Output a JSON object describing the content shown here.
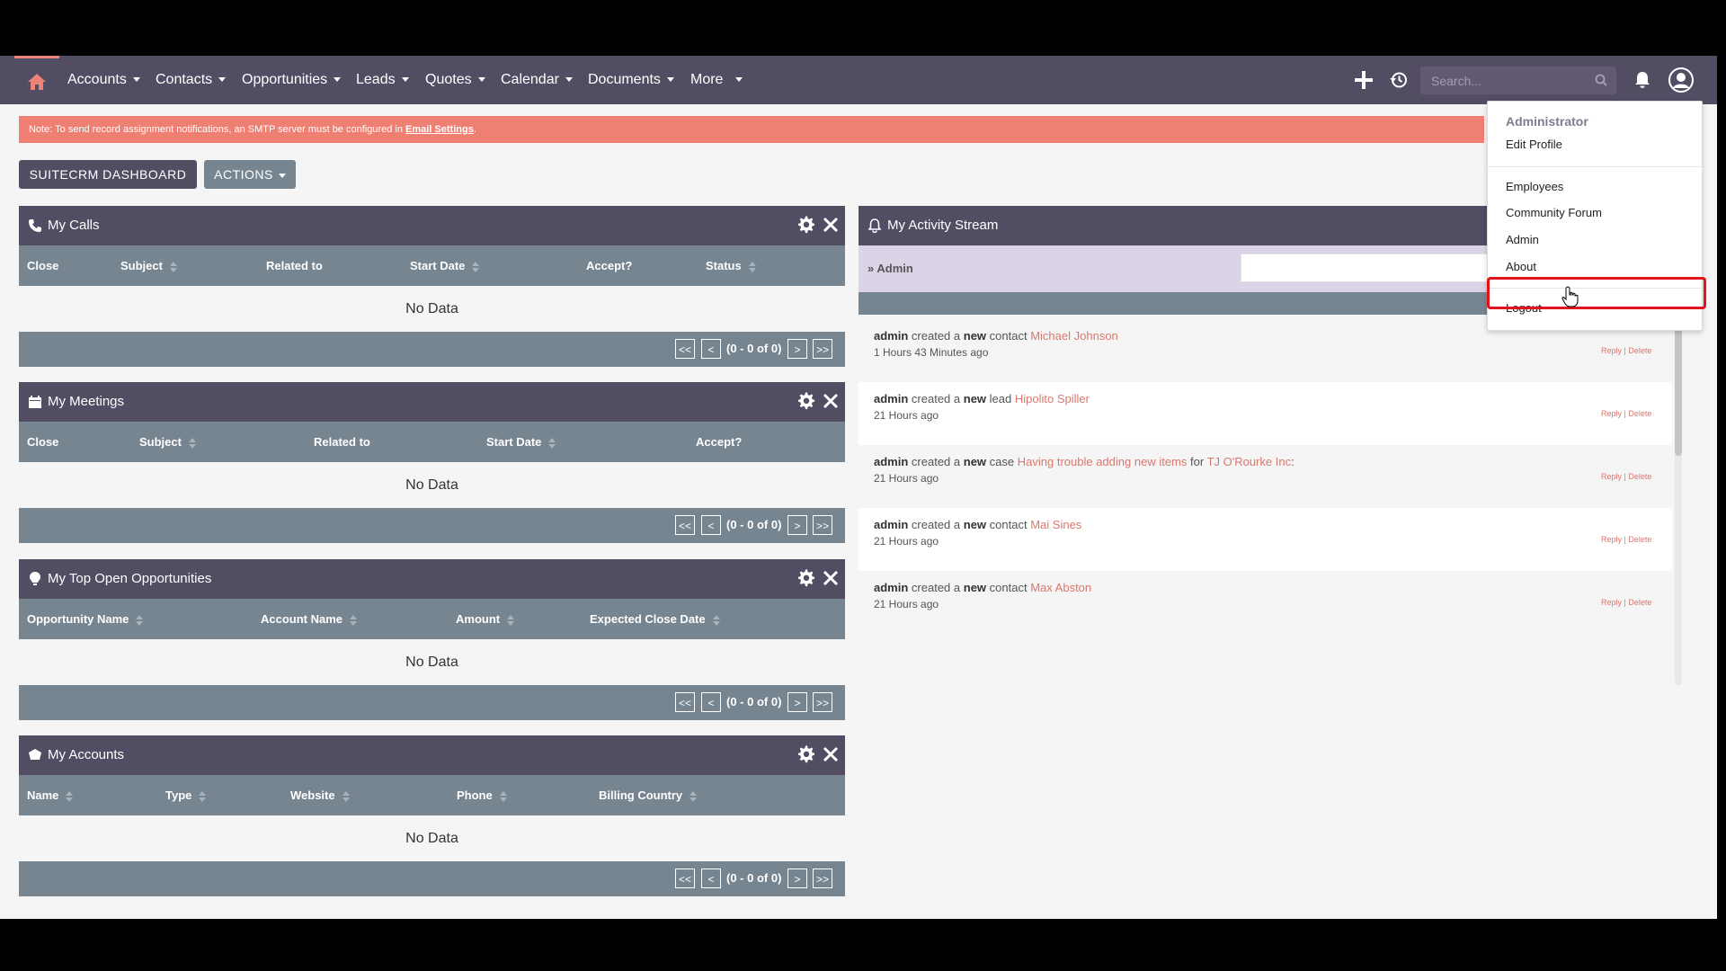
{
  "nav": {
    "items": [
      {
        "label": "Accounts"
      },
      {
        "label": "Contacts"
      },
      {
        "label": "Opportunities"
      },
      {
        "label": "Leads"
      },
      {
        "label": "Quotes"
      },
      {
        "label": "Calendar"
      },
      {
        "label": "Documents"
      },
      {
        "label": "More"
      }
    ],
    "search_placeholder": "Search..."
  },
  "note": {
    "text": "Note: To send record assignment notifications, an SMTP server must be configured in ",
    "link": "Email Settings",
    "suffix": "."
  },
  "buttons": {
    "dashboard": "SUITECRM DASHBOARD",
    "actions": "ACTIONS"
  },
  "dashlets": {
    "calls": {
      "title": "My Calls",
      "columns": [
        "Close",
        "Subject",
        "Related to",
        "Start Date",
        "Accept?",
        "Status"
      ],
      "empty": "No Data",
      "pagination": "(0 - 0 of 0)"
    },
    "meetings": {
      "title": "My Meetings",
      "columns": [
        "Close",
        "Subject",
        "Related to",
        "Start Date",
        "Accept?"
      ],
      "empty": "No Data",
      "pagination": "(0 - 0 of 0)"
    },
    "opportunities": {
      "title": "My Top Open Opportunities",
      "columns": [
        "Opportunity Name",
        "Account Name",
        "Amount",
        "Expected Close Date"
      ],
      "empty": "No Data",
      "pagination": "(0 - 0 of 0)"
    },
    "accounts": {
      "title": "My Accounts",
      "columns": [
        "Name",
        "Type",
        "Website",
        "Phone",
        "Billing Country"
      ],
      "empty": "No Data",
      "pagination": "(0 - 0 of 0)"
    }
  },
  "pager": {
    "first": "<<",
    "prev": "<",
    "next": ">",
    "last": ">>"
  },
  "activity": {
    "title": "My Activity Stream",
    "user_filter": "Admin",
    "entries": [
      {
        "actor": "admin",
        "verb": "created a",
        "kw": "new",
        "type": "contact",
        "target": "Michael Johnson",
        "extra_pre": "",
        "extra_link": "",
        "extra_post": "",
        "time": "1 Hours 43 Minutes ago"
      },
      {
        "actor": "admin",
        "verb": "created a",
        "kw": "new",
        "type": "lead",
        "target": "Hipolito Spiller",
        "extra_pre": "",
        "extra_link": "",
        "extra_post": "",
        "time": "21 Hours ago"
      },
      {
        "actor": "admin",
        "verb": "created a",
        "kw": "new",
        "type": "case",
        "target": "Having trouble adding new items",
        "extra_pre": "for",
        "extra_link": "TJ O'Rourke Inc",
        "extra_post": ":",
        "time": "21 Hours ago"
      },
      {
        "actor": "admin",
        "verb": "created a",
        "kw": "new",
        "type": "contact",
        "target": "Mai Sines",
        "extra_pre": "",
        "extra_link": "",
        "extra_post": "",
        "time": "21 Hours ago"
      },
      {
        "actor": "admin",
        "verb": "created a",
        "kw": "new",
        "type": "contact",
        "target": "Max Abston",
        "extra_pre": "",
        "extra_link": "",
        "extra_post": "",
        "time": "21 Hours ago"
      }
    ],
    "reply": "Reply",
    "delete": "Delete"
  },
  "user_menu": {
    "heading": "Administrator",
    "items": [
      "Edit Profile",
      "Employees",
      "Community Forum",
      "Admin",
      "About",
      "Logout"
    ]
  },
  "colors": {
    "nav_bg": "#534d64",
    "header_cols": "#778591",
    "accent": "#ef7f73",
    "highlight": "#e3121b"
  }
}
